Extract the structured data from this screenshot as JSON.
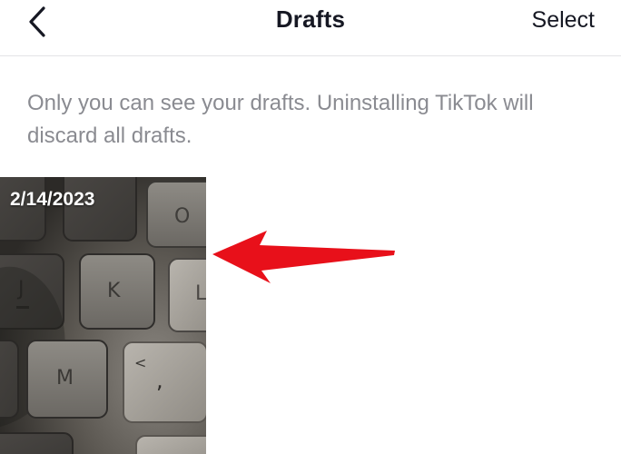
{
  "header": {
    "title": "Drafts",
    "select_label": "Select",
    "back_icon": "chevron-left-icon"
  },
  "notice": {
    "text": "Only you can see your drafts. Uninstalling TikTok will discard all drafts."
  },
  "drafts": [
    {
      "date": "2/14/2023",
      "thumbnail_keys": [
        "O",
        "J",
        "K",
        "L",
        "M",
        "<",
        ","
      ]
    }
  ],
  "annotation": {
    "arrow_color": "#e8101a"
  },
  "colors": {
    "text_primary": "#161823",
    "text_secondary": "#8a8b91",
    "divider": "#e3e3e6"
  }
}
